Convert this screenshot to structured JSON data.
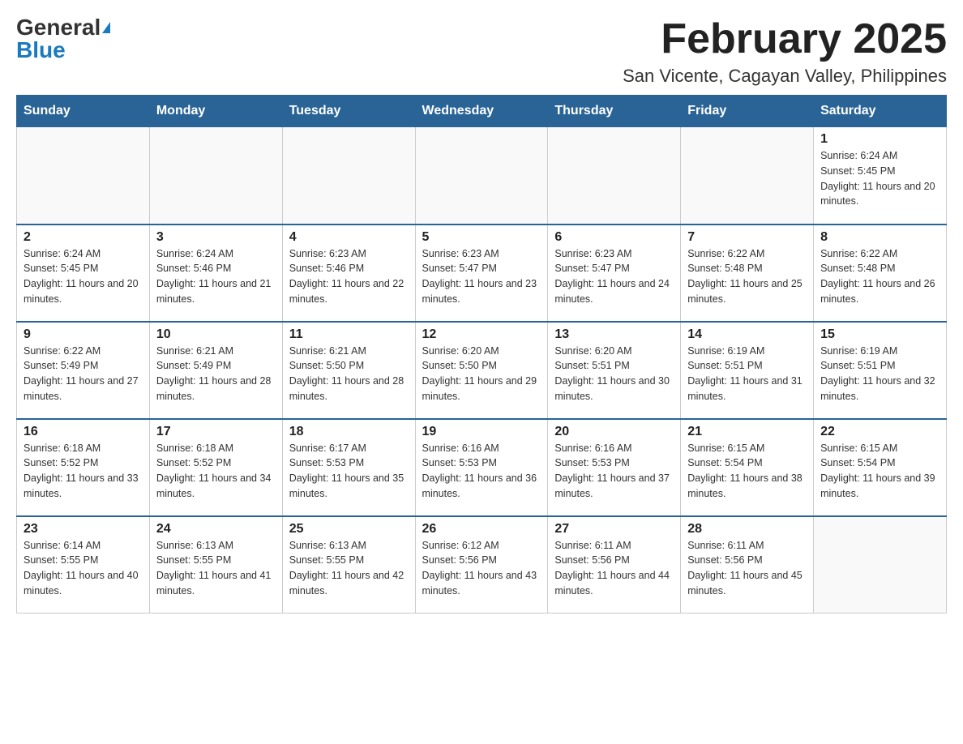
{
  "header": {
    "logo_general": "General",
    "logo_blue": "Blue",
    "month_title": "February 2025",
    "location": "San Vicente, Cagayan Valley, Philippines"
  },
  "weekdays": [
    "Sunday",
    "Monday",
    "Tuesday",
    "Wednesday",
    "Thursday",
    "Friday",
    "Saturday"
  ],
  "weeks": [
    [
      {
        "day": "",
        "info": ""
      },
      {
        "day": "",
        "info": ""
      },
      {
        "day": "",
        "info": ""
      },
      {
        "day": "",
        "info": ""
      },
      {
        "day": "",
        "info": ""
      },
      {
        "day": "",
        "info": ""
      },
      {
        "day": "1",
        "info": "Sunrise: 6:24 AM\nSunset: 5:45 PM\nDaylight: 11 hours and 20 minutes."
      }
    ],
    [
      {
        "day": "2",
        "info": "Sunrise: 6:24 AM\nSunset: 5:45 PM\nDaylight: 11 hours and 20 minutes."
      },
      {
        "day": "3",
        "info": "Sunrise: 6:24 AM\nSunset: 5:46 PM\nDaylight: 11 hours and 21 minutes."
      },
      {
        "day": "4",
        "info": "Sunrise: 6:23 AM\nSunset: 5:46 PM\nDaylight: 11 hours and 22 minutes."
      },
      {
        "day": "5",
        "info": "Sunrise: 6:23 AM\nSunset: 5:47 PM\nDaylight: 11 hours and 23 minutes."
      },
      {
        "day": "6",
        "info": "Sunrise: 6:23 AM\nSunset: 5:47 PM\nDaylight: 11 hours and 24 minutes."
      },
      {
        "day": "7",
        "info": "Sunrise: 6:22 AM\nSunset: 5:48 PM\nDaylight: 11 hours and 25 minutes."
      },
      {
        "day": "8",
        "info": "Sunrise: 6:22 AM\nSunset: 5:48 PM\nDaylight: 11 hours and 26 minutes."
      }
    ],
    [
      {
        "day": "9",
        "info": "Sunrise: 6:22 AM\nSunset: 5:49 PM\nDaylight: 11 hours and 27 minutes."
      },
      {
        "day": "10",
        "info": "Sunrise: 6:21 AM\nSunset: 5:49 PM\nDaylight: 11 hours and 28 minutes."
      },
      {
        "day": "11",
        "info": "Sunrise: 6:21 AM\nSunset: 5:50 PM\nDaylight: 11 hours and 28 minutes."
      },
      {
        "day": "12",
        "info": "Sunrise: 6:20 AM\nSunset: 5:50 PM\nDaylight: 11 hours and 29 minutes."
      },
      {
        "day": "13",
        "info": "Sunrise: 6:20 AM\nSunset: 5:51 PM\nDaylight: 11 hours and 30 minutes."
      },
      {
        "day": "14",
        "info": "Sunrise: 6:19 AM\nSunset: 5:51 PM\nDaylight: 11 hours and 31 minutes."
      },
      {
        "day": "15",
        "info": "Sunrise: 6:19 AM\nSunset: 5:51 PM\nDaylight: 11 hours and 32 minutes."
      }
    ],
    [
      {
        "day": "16",
        "info": "Sunrise: 6:18 AM\nSunset: 5:52 PM\nDaylight: 11 hours and 33 minutes."
      },
      {
        "day": "17",
        "info": "Sunrise: 6:18 AM\nSunset: 5:52 PM\nDaylight: 11 hours and 34 minutes."
      },
      {
        "day": "18",
        "info": "Sunrise: 6:17 AM\nSunset: 5:53 PM\nDaylight: 11 hours and 35 minutes."
      },
      {
        "day": "19",
        "info": "Sunrise: 6:16 AM\nSunset: 5:53 PM\nDaylight: 11 hours and 36 minutes."
      },
      {
        "day": "20",
        "info": "Sunrise: 6:16 AM\nSunset: 5:53 PM\nDaylight: 11 hours and 37 minutes."
      },
      {
        "day": "21",
        "info": "Sunrise: 6:15 AM\nSunset: 5:54 PM\nDaylight: 11 hours and 38 minutes."
      },
      {
        "day": "22",
        "info": "Sunrise: 6:15 AM\nSunset: 5:54 PM\nDaylight: 11 hours and 39 minutes."
      }
    ],
    [
      {
        "day": "23",
        "info": "Sunrise: 6:14 AM\nSunset: 5:55 PM\nDaylight: 11 hours and 40 minutes."
      },
      {
        "day": "24",
        "info": "Sunrise: 6:13 AM\nSunset: 5:55 PM\nDaylight: 11 hours and 41 minutes."
      },
      {
        "day": "25",
        "info": "Sunrise: 6:13 AM\nSunset: 5:55 PM\nDaylight: 11 hours and 42 minutes."
      },
      {
        "day": "26",
        "info": "Sunrise: 6:12 AM\nSunset: 5:56 PM\nDaylight: 11 hours and 43 minutes."
      },
      {
        "day": "27",
        "info": "Sunrise: 6:11 AM\nSunset: 5:56 PM\nDaylight: 11 hours and 44 minutes."
      },
      {
        "day": "28",
        "info": "Sunrise: 6:11 AM\nSunset: 5:56 PM\nDaylight: 11 hours and 45 minutes."
      },
      {
        "day": "",
        "info": ""
      }
    ]
  ]
}
